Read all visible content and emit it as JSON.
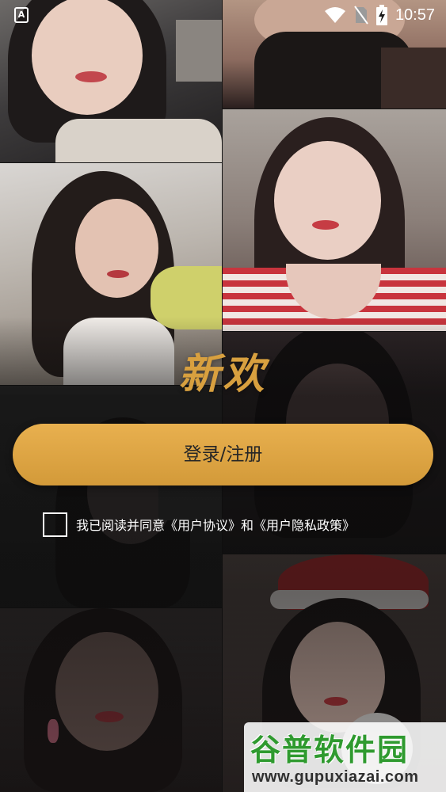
{
  "status_bar": {
    "left_icon": "A",
    "time": "10:57",
    "icons": [
      "wifi-icon",
      "no-sim-icon",
      "battery-charging-icon"
    ]
  },
  "app": {
    "title": "新欢"
  },
  "login": {
    "button_label": "登录/注册"
  },
  "agreement": {
    "checked": false,
    "prefix": "我已阅读并同意",
    "user_agreement": "《用户协议》",
    "conjunction": "和",
    "privacy_policy": "《用户隐私政策》"
  },
  "watermark": {
    "logo_text": "谷普软件园",
    "url": "www.gupuxiazai.com"
  },
  "colors": {
    "accent": "#d8a03f",
    "button": "#e2aa48",
    "watermark_green": "#2f9a2f"
  }
}
